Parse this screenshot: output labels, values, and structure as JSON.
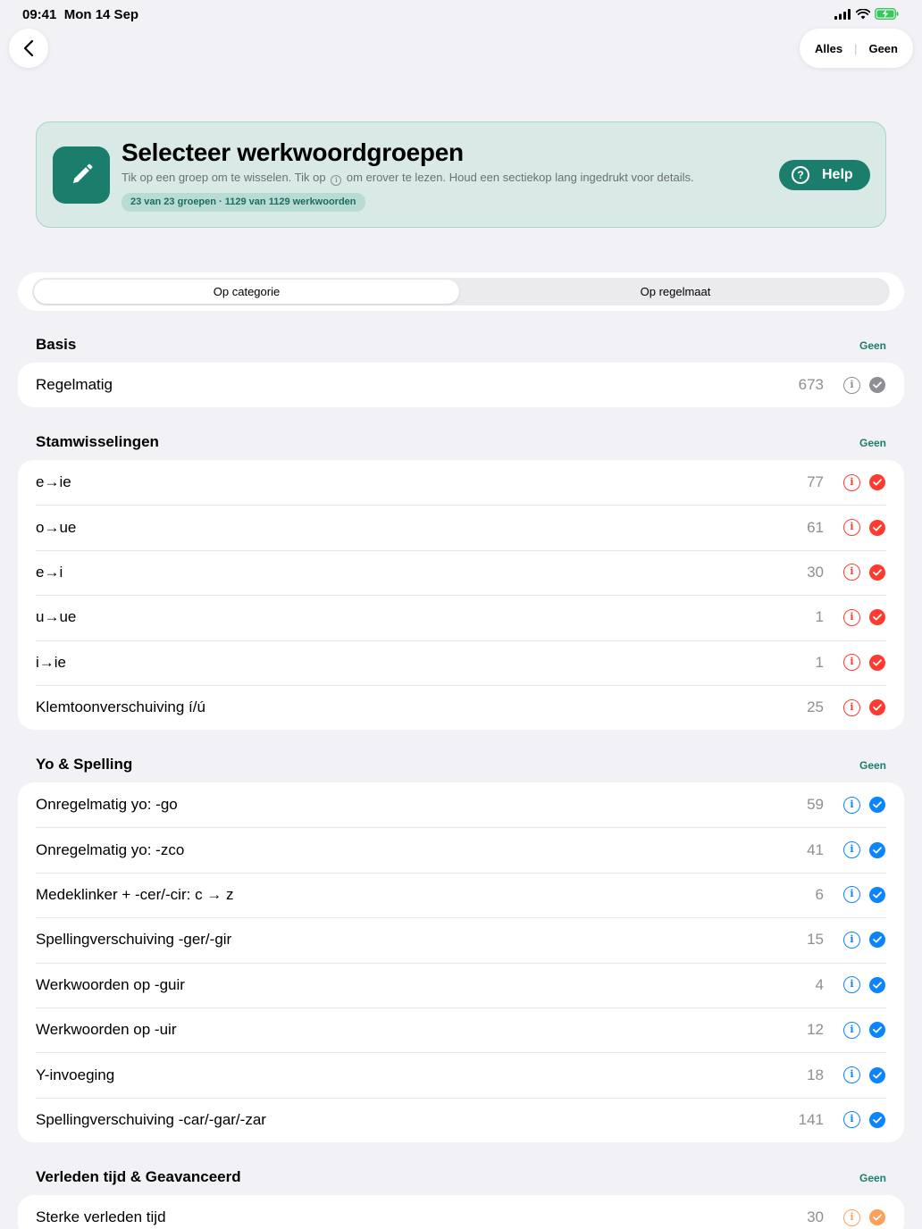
{
  "status": {
    "time": "09:41",
    "date": "Mon 14 Sep"
  },
  "nav": {
    "select_all": "Alles",
    "select_none": "Geen"
  },
  "header": {
    "title": "Selecteer werkwoordgroepen",
    "subtitle_before": "Tik op een groep om te wisselen. Tik op",
    "subtitle_after": "om erover te lezen. Houd een sectiekop lang ingedrukt voor details.",
    "badge": "23 van 23 groepen · 1129 van 1129 werkwoorden",
    "help_label": "Help",
    "accent": "#1b7d6b"
  },
  "segments": {
    "tab1": "Op categorie",
    "tab2": "Op regelmaat",
    "selected": "Op categorie"
  },
  "sections": [
    {
      "title": "Basis",
      "action": "Geen",
      "color": "#8e8e93",
      "rows": [
        {
          "label": "Regelmatig",
          "count": "673",
          "selected": true
        }
      ]
    },
    {
      "title": "Stamwisselingen",
      "action": "Geen",
      "color": "#ff3b30",
      "rows": [
        {
          "label": "e→ie",
          "count": "77",
          "selected": true
        },
        {
          "label": "o→ue",
          "count": "61",
          "selected": true
        },
        {
          "label": "e→i",
          "count": "30",
          "selected": true
        },
        {
          "label": "u→ue",
          "count": "1",
          "selected": true
        },
        {
          "label": "i→ie",
          "count": "1",
          "selected": true
        },
        {
          "label": "Klemtoonverschuiving í/ú",
          "count": "25",
          "selected": true
        }
      ]
    },
    {
      "title": "Yo & Spelling",
      "action": "Geen",
      "color": "#0a84ff",
      "rows": [
        {
          "label": "Onregelmatig yo: -go",
          "count": "59",
          "selected": true
        },
        {
          "label": "Onregelmatig yo: -zco",
          "count": "41",
          "selected": true
        },
        {
          "label": "Medeklinker + -cer/-cir: c → z",
          "count": "6",
          "selected": true
        },
        {
          "label": "Spellingverschuiving -ger/-gir",
          "count": "15",
          "selected": true
        },
        {
          "label": "Werkwoorden op -guir",
          "count": "4",
          "selected": true
        },
        {
          "label": "Werkwoorden op -uir",
          "count": "12",
          "selected": true
        },
        {
          "label": "Y-invoeging",
          "count": "18",
          "selected": true
        },
        {
          "label": "Spellingverschuiving -car/-gar/-zar",
          "count": "141",
          "selected": true
        }
      ]
    },
    {
      "title": "Verleden tijd & Geavanceerd",
      "action": "Geen",
      "color": "#ff9f5a",
      "rows": [
        {
          "label": "Sterke verleden tijd",
          "count": "30",
          "selected": true
        }
      ]
    }
  ]
}
